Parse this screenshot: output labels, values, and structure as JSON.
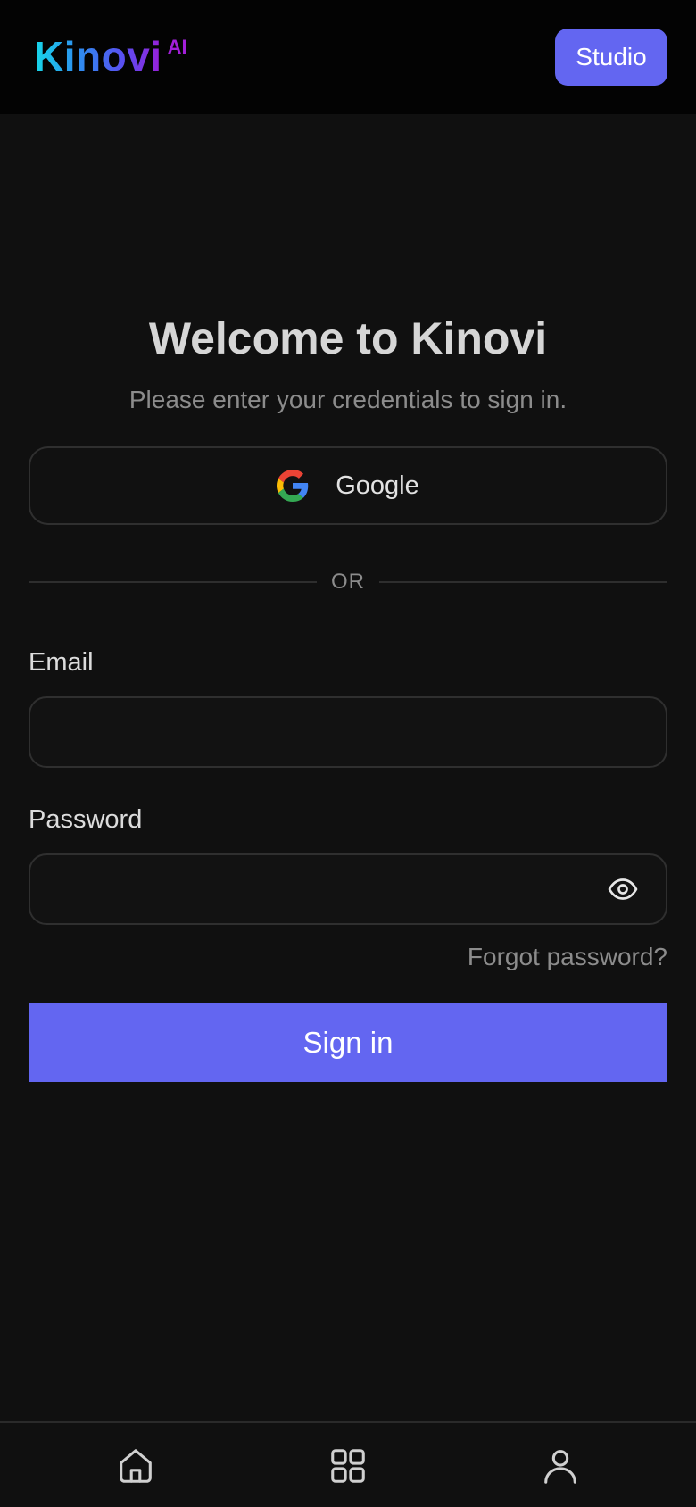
{
  "header": {
    "logo_text": "Kinovi",
    "logo_superscript": "AI",
    "studio_label": "Studio"
  },
  "signin": {
    "title": "Welcome to Kinovi",
    "subtitle": "Please enter your credentials to sign in.",
    "google_label": "Google",
    "divider_text": "OR",
    "email_label": "Email",
    "email_value": "",
    "password_label": "Password",
    "password_value": "",
    "forgot_label": "Forgot password?",
    "submit_label": "Sign in"
  },
  "bottom_nav": {
    "items": [
      {
        "icon": "home-icon"
      },
      {
        "icon": "grid-icon"
      },
      {
        "icon": "user-icon"
      }
    ]
  },
  "colors": {
    "background": "#101010",
    "header_background": "#030303",
    "accent": "#6366f1",
    "border": "#2f2f2f",
    "muted_text": "#8c8c8c"
  }
}
